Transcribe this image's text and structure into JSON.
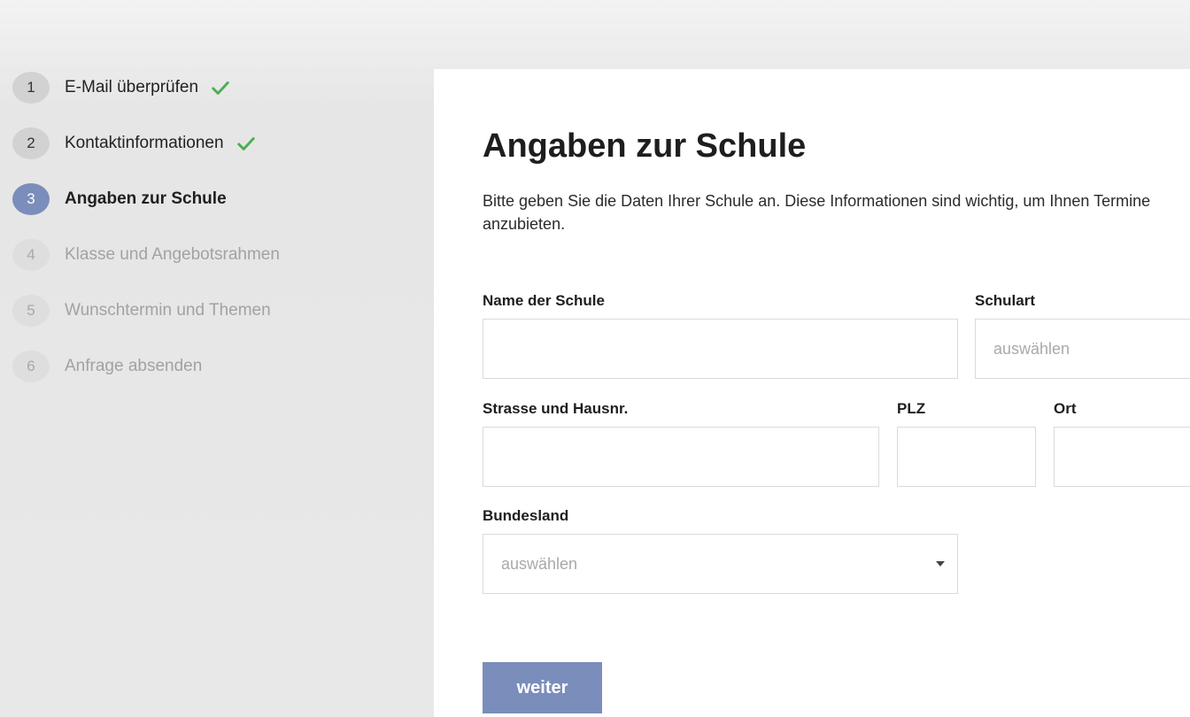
{
  "steps": [
    {
      "number": "1",
      "label": "E-Mail überprüfen",
      "status": "done"
    },
    {
      "number": "2",
      "label": "Kontaktinformationen",
      "status": "done"
    },
    {
      "number": "3",
      "label": "Angaben zur Schule",
      "status": "active"
    },
    {
      "number": "4",
      "label": "Klasse und Angebotsrahmen",
      "status": "todo"
    },
    {
      "number": "5",
      "label": "Wunschtermin und Themen",
      "status": "todo"
    },
    {
      "number": "6",
      "label": "Anfrage absenden",
      "status": "todo"
    }
  ],
  "main": {
    "title": "Angaben zur Schule",
    "intro": "Bitte geben Sie die Daten Ihrer Schule an. Diese Informationen sind wichtig, um Ihnen Termine anzubieten."
  },
  "form": {
    "school_name": {
      "label": "Name der Schule",
      "value": ""
    },
    "school_type": {
      "label": "Schulart",
      "placeholder": "auswählen"
    },
    "street": {
      "label": "Strasse und Hausnr.",
      "value": ""
    },
    "zip": {
      "label": "PLZ",
      "value": ""
    },
    "city": {
      "label": "Ort",
      "value": ""
    },
    "state": {
      "label": "Bundesland",
      "placeholder": "auswählen"
    }
  },
  "actions": {
    "next_label": "weiter"
  },
  "colors": {
    "accent": "#7b8dbb",
    "check_green": "#4caf50",
    "done_step_bg": "#d2d2d2",
    "todo_text": "#a2a2a2"
  },
  "icons": {
    "done_step": "checkmark-icon",
    "dropdown": "caret-down-icon"
  }
}
